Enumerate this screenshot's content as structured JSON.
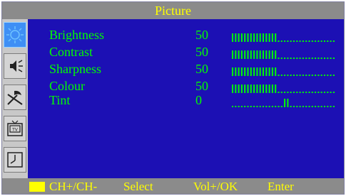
{
  "title": "Picture",
  "sidebar": {
    "items": [
      {
        "icon": "sun-icon",
        "active": true
      },
      {
        "icon": "speaker-icon",
        "active": false
      },
      {
        "icon": "tools-icon",
        "active": false
      },
      {
        "icon": "tv-icon",
        "active": false
      },
      {
        "icon": "clock-icon",
        "active": false
      }
    ]
  },
  "menu": {
    "items": [
      {
        "label": "Brightness",
        "value": "50",
        "level": 0.5,
        "type": "bar"
      },
      {
        "label": "Contrast",
        "value": "50",
        "level": 0.5,
        "type": "bar"
      },
      {
        "label": "Sharpness",
        "value": "50",
        "level": 0.5,
        "type": "bar"
      },
      {
        "label": "Colour",
        "value": "50",
        "level": 0.5,
        "type": "bar"
      },
      {
        "label": "Tint",
        "value": "0",
        "level": 0.5,
        "type": "center"
      }
    ]
  },
  "footer": {
    "nav": "CH+/CH-",
    "select": "Select",
    "vol": "Vol+/OK",
    "enter": "Enter"
  },
  "colors": {
    "background": "#1c10b4",
    "text": "#00ff00",
    "title": "#ffff00",
    "bar": "#00ff00"
  }
}
